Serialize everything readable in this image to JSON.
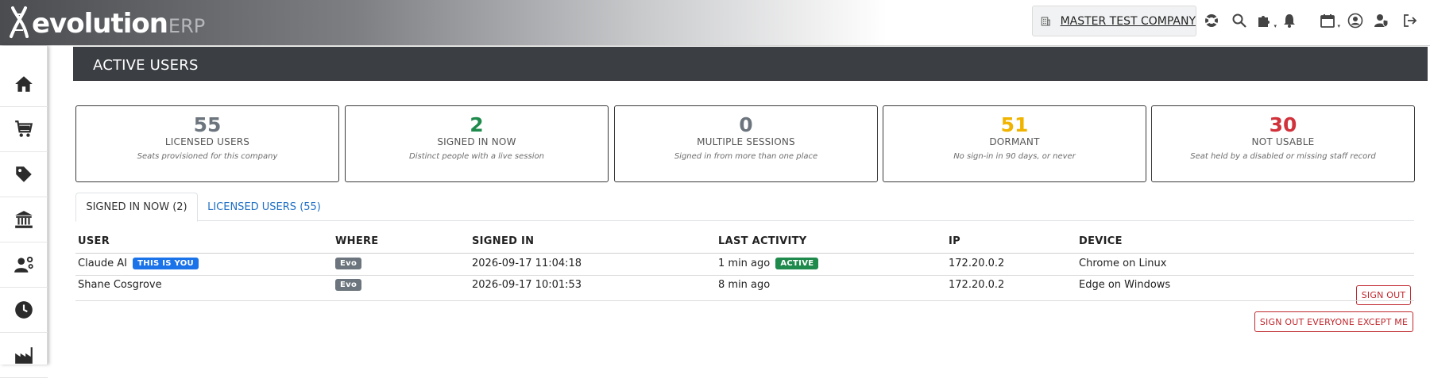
{
  "app": {
    "logo_main": "evolution",
    "logo_sub": "ERP",
    "company": "MASTER TEST COMPANY"
  },
  "topbar_icons": [
    "building-icon",
    "lifebuoy-icon",
    "search-icon",
    "puzzle-icon",
    "bell-icon",
    "calendar-icon",
    "user-circle-icon",
    "user-shield-icon",
    "sign-out-icon"
  ],
  "sidebar": {
    "items": [
      "home-icon",
      "cart-icon",
      "tag-icon",
      "bank-icon",
      "user-gear-icon",
      "clock-icon",
      "factory-icon"
    ]
  },
  "page": {
    "title": "ACTIVE USERS"
  },
  "cards": [
    {
      "value": "55",
      "label": "LICENSED USERS",
      "desc": "Seats provisioned for this company",
      "color": "#6c757d"
    },
    {
      "value": "2",
      "label": "SIGNED IN NOW",
      "desc": "Distinct people with a live session",
      "color": "#1e8a4c"
    },
    {
      "value": "0",
      "label": "MULTIPLE SESSIONS",
      "desc": "Signed in from more than one place",
      "color": "#6c757d"
    },
    {
      "value": "51",
      "label": "DORMANT",
      "desc": "No sign-in in 90 days, or never",
      "color": "#f0b400"
    },
    {
      "value": "30",
      "label": "NOT USABLE",
      "desc": "Seat held by a disabled or missing staff record",
      "color": "#d1323b"
    }
  ],
  "tabs": {
    "signed_in": "SIGNED IN NOW (2)",
    "licensed": "LICENSED USERS (55)"
  },
  "table": {
    "headers": {
      "user": "USER",
      "where": "WHERE",
      "signed_in": "SIGNED IN",
      "last_activity": "LAST ACTIVITY",
      "ip": "IP",
      "device": "DEVICE"
    },
    "rows": [
      {
        "user": "Claude AI",
        "you_badge": "THIS IS YOU",
        "where": "Evo",
        "signed_in": "2026-09-17 11:04:18",
        "last_activity": "1 min ago",
        "status_badge": "ACTIVE",
        "ip": "172.20.0.2",
        "device": "Chrome on Linux"
      },
      {
        "user": "Shane Cosgrove",
        "where": "Evo",
        "signed_in": "2026-09-17 10:01:53",
        "last_activity": "8 min ago",
        "ip": "172.20.0.2",
        "device": "Edge on Windows",
        "action": "SIGN OUT"
      }
    ]
  },
  "actions": {
    "sign_out_everyone": "SIGN OUT EVERYONE EXCEPT ME"
  },
  "colors": {
    "header_bg": "#3b3e43",
    "link": "#1f6fc5",
    "danger": "#c0272d"
  }
}
